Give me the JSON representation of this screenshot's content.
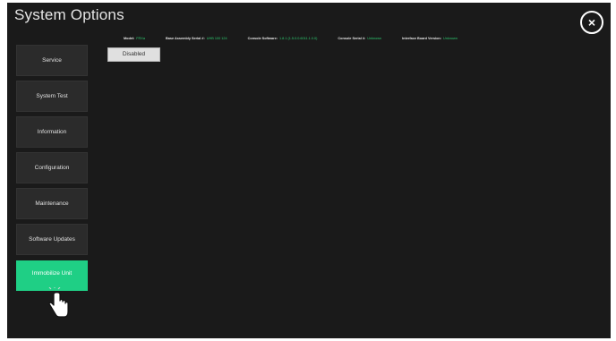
{
  "header": {
    "title": "System Options",
    "close_label": "×"
  },
  "info_bar": [
    {
      "label": "Model:",
      "value": "FRXa"
    },
    {
      "label": "Base Assembly Serial #:",
      "value": "UHB 100 124"
    },
    {
      "label": "Console Software:",
      "value": "1.8.1 (1.5.0.0.6011.1.0.0)"
    },
    {
      "label": "Console Serial #:",
      "value": "Unknown"
    },
    {
      "label": "Interface Board Version:",
      "value": "Unknown"
    }
  ],
  "status_box": "Disabled",
  "sidebar": {
    "items": [
      {
        "label": "Service"
      },
      {
        "label": "System Test"
      },
      {
        "label": "Information"
      },
      {
        "label": "Configuration"
      },
      {
        "label": "Maintenance"
      },
      {
        "label": "Software Updates"
      },
      {
        "label": "Immobilize Unit",
        "active": true
      }
    ]
  },
  "colors": {
    "background": "#1a1a1a",
    "accent": "#1fcf85",
    "value_text": "#2ecc71"
  },
  "cursor": {
    "icon": "hand-pointer-icon"
  }
}
